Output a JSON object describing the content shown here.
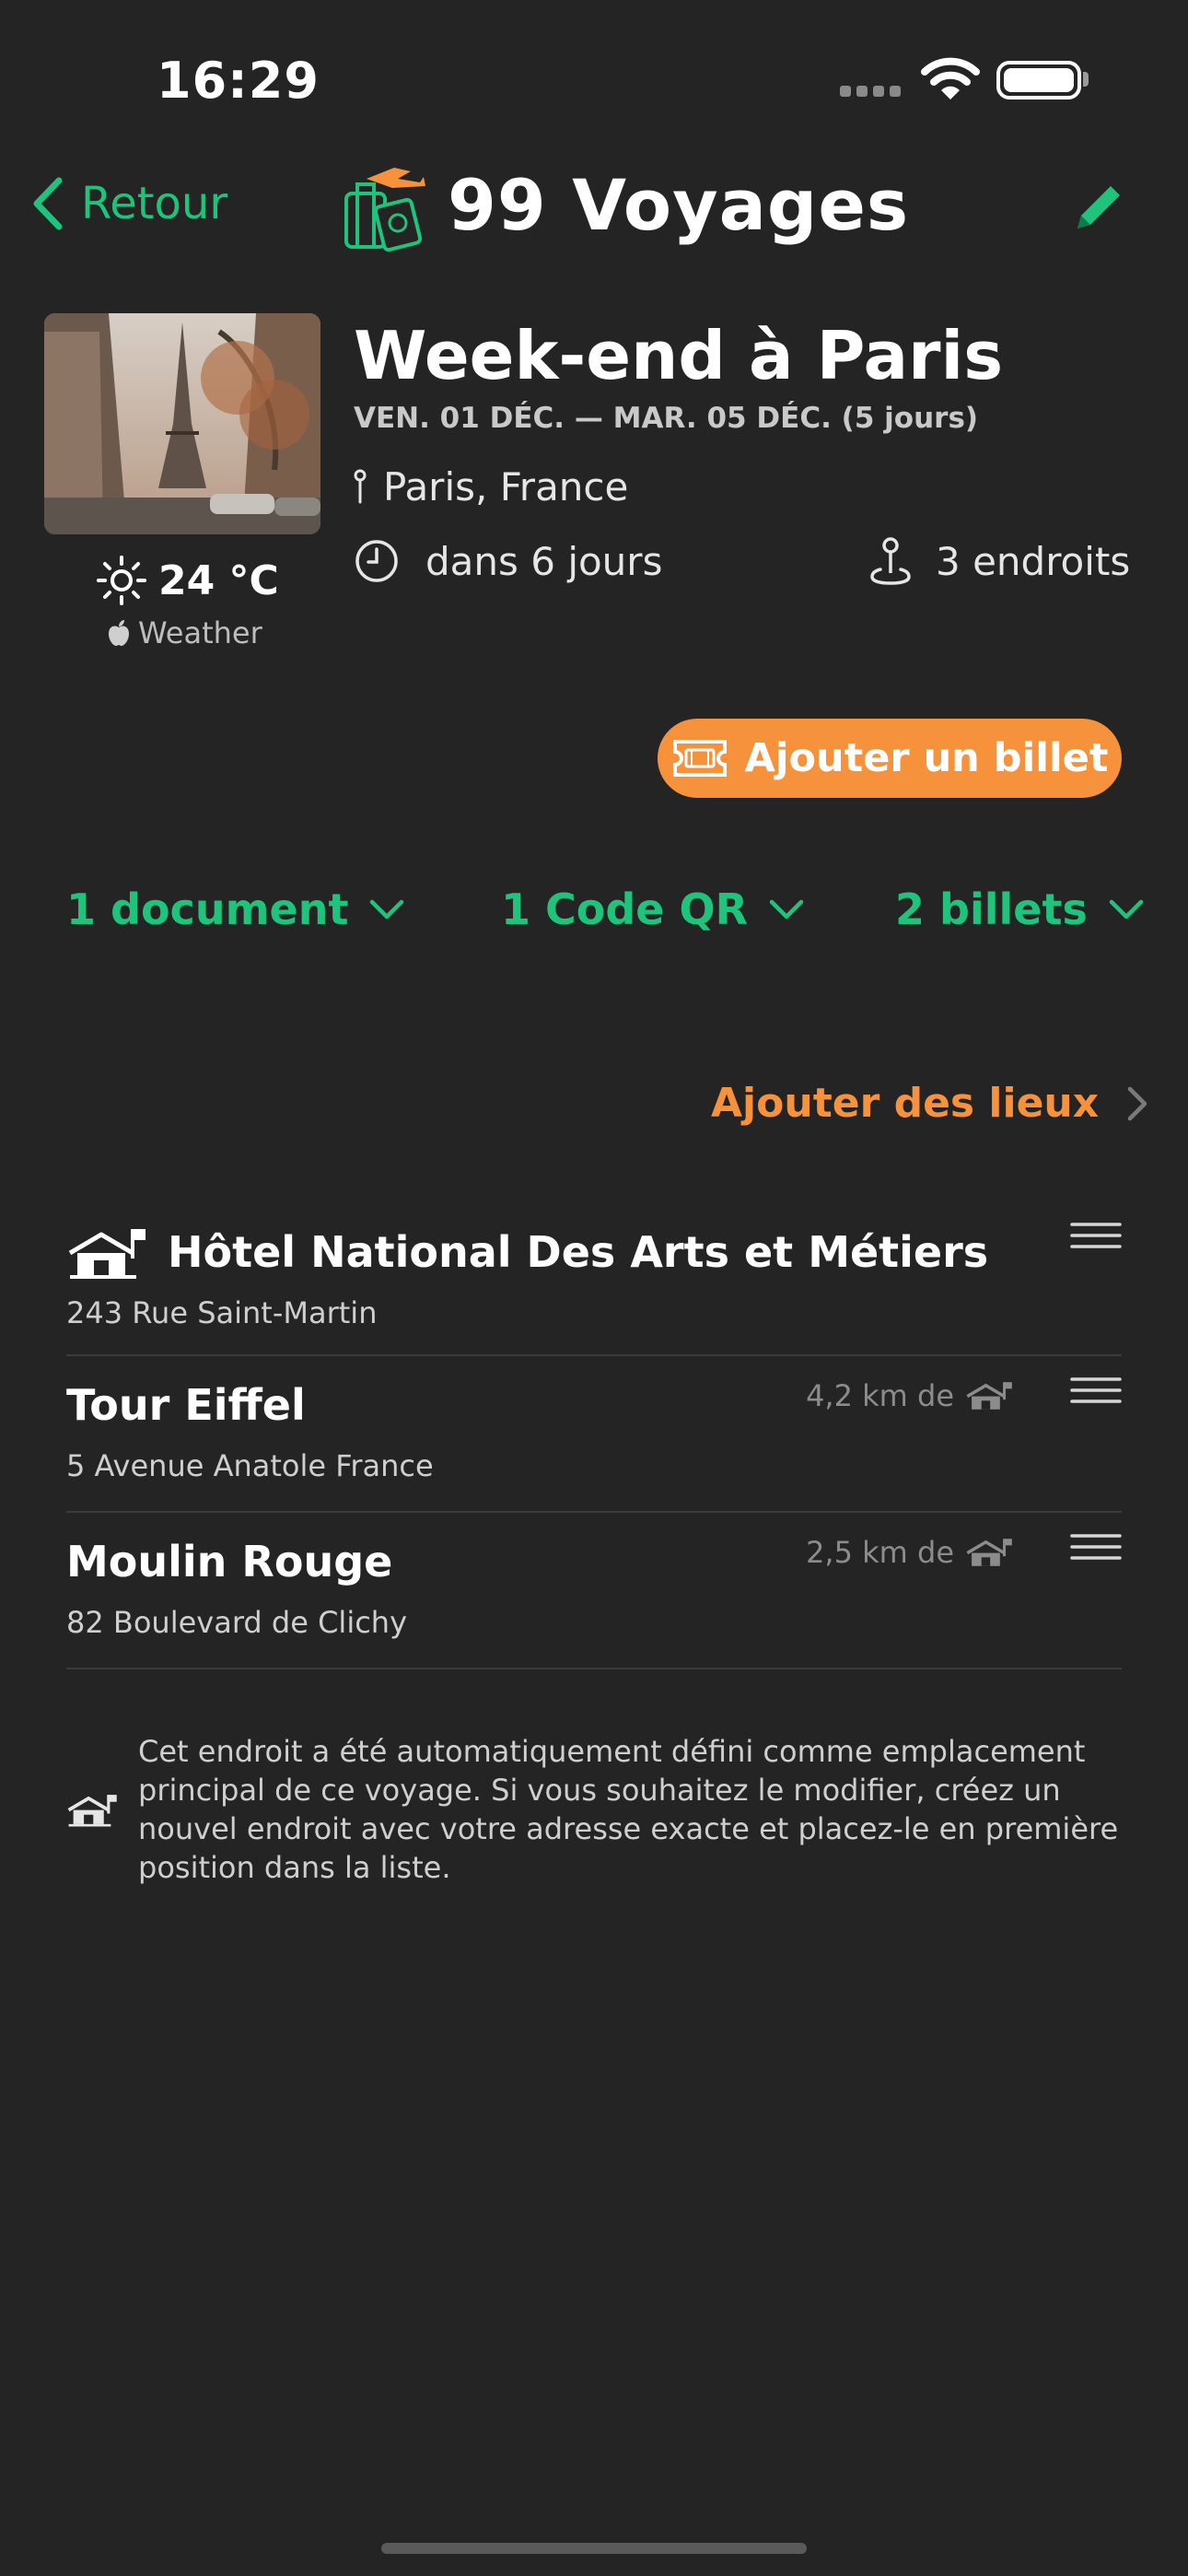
{
  "status_bar": {
    "time": "16:29"
  },
  "nav": {
    "back_label": "Retour",
    "title": "99 Voyages",
    "logo_icon": "travel-luggage-icon",
    "edit_icon": "pencil-icon"
  },
  "trip": {
    "title": "Week-end à Paris",
    "dates": "VEN. 01 DÉC. — MAR. 05 DÉC.  (5 jours)",
    "location": "Paris, France",
    "countdown": "dans 6 jours",
    "places_count": "3 endroits",
    "photo_subject": "eiffel-tower-photo"
  },
  "weather": {
    "temperature": "24 °C",
    "source": "Weather"
  },
  "actions": {
    "add_ticket": "Ajouter un billet",
    "add_places": "Ajouter des lieux"
  },
  "dropdowns": {
    "documents": "1 document",
    "qr_codes": "1 Code QR",
    "tickets": "2 billets"
  },
  "places": [
    {
      "name": "Hôtel National Des Arts et Métiers",
      "address": "243 Rue Saint-Martin",
      "is_main": true,
      "distance": ""
    },
    {
      "name": "Tour Eiffel",
      "address": "5 Avenue Anatole France",
      "is_main": false,
      "distance": "4,2 km de"
    },
    {
      "name": "Moulin Rouge",
      "address": "82 Boulevard de Clichy",
      "is_main": false,
      "distance": "2,5 km de"
    }
  ],
  "note": "Cet endroit a été automatiquement défini comme emplacement principal de ce voyage. Si vous souhaitez le modifier, créez un nouvel endroit avec votre adresse exacte et placez-le en première position dans la liste.",
  "colors": {
    "background": "#242424",
    "accent_green": "#1fc47c",
    "accent_orange": "#f6913c"
  }
}
